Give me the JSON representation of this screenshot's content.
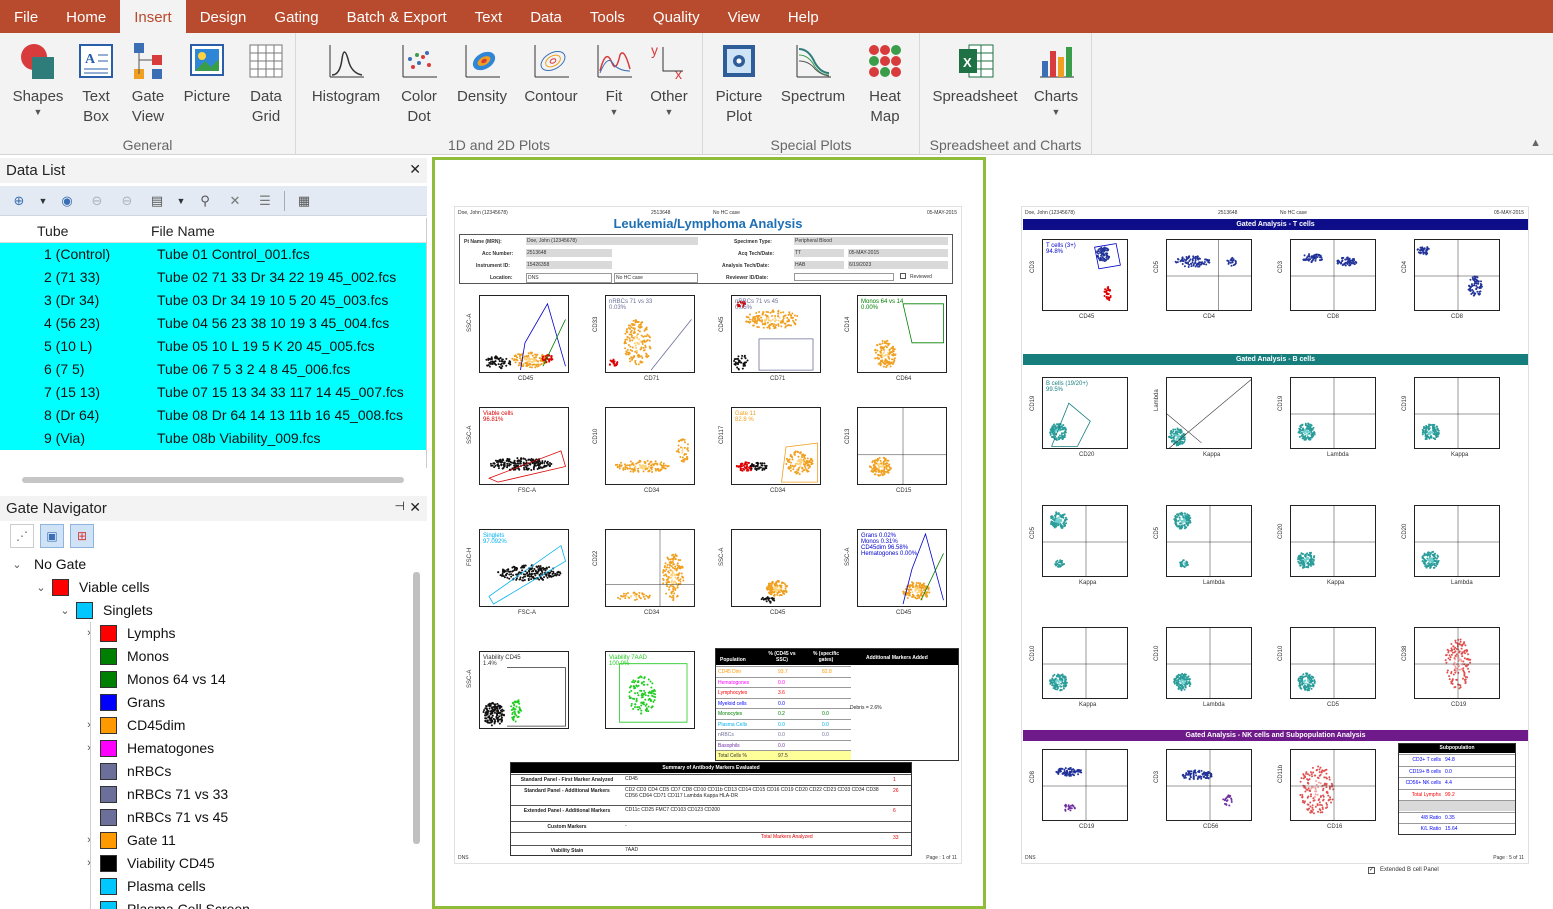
{
  "menu": [
    "File",
    "Home",
    "Insert",
    "Design",
    "Gating",
    "Batch & Export",
    "Text",
    "Data",
    "Tools",
    "Quality",
    "View",
    "Help"
  ],
  "ribbon": {
    "general": {
      "label": "General",
      "buttons": [
        "Shapes",
        "Text\nBox",
        "Gate\nView",
        "Picture",
        "Data\nGrid"
      ]
    },
    "plots": {
      "label": "1D and 2D Plots",
      "buttons": [
        "Histogram",
        "Color\nDot",
        "Density",
        "Contour",
        "Fit",
        "Other"
      ]
    },
    "special": {
      "label": "Special Plots",
      "buttons": [
        "Picture\nPlot",
        "Spectrum",
        "Heat\nMap"
      ]
    },
    "sheet": {
      "label": "Spreadsheet and Charts",
      "buttons": [
        "Spreadsheet",
        "Charts"
      ]
    }
  },
  "datalist": {
    "title": "Data List",
    "col_tube": "Tube",
    "col_file": "File Name",
    "rows": [
      {
        "tube": "1 (Control)",
        "file": "Tube 01 Control_001.fcs"
      },
      {
        "tube": "2 (71 33)",
        "file": "Tube 02 71 33 Dr 34 22 19 45_002.fcs"
      },
      {
        "tube": "3 (Dr 34)",
        "file": "Tube 03 Dr 34 19 10 5 20 45_003.fcs"
      },
      {
        "tube": "4 (56 23)",
        "file": "Tube 04 56 23 38 10 19 3 45_004.fcs"
      },
      {
        "tube": "5 (10 L)",
        "file": "Tube 05 10 L 19 5 K 20 45_005.fcs"
      },
      {
        "tube": "6 (7 5)",
        "file": "Tube 06 7 5 3 2 4 8 45_006.fcs"
      },
      {
        "tube": "7 (15 13)",
        "file": "Tube 07 15 13 34 33 117 14 45_007.fcs"
      },
      {
        "tube": "8 (Dr 64)",
        "file": "Tube 08 Dr 64 14 13 11b 16 45_008.fcs"
      },
      {
        "tube": "9 (Via)",
        "file": "Tube 08b Viability_009.fcs"
      }
    ]
  },
  "gatenav": {
    "title": "Gate Navigator",
    "root": "No Gate",
    "nodes": [
      {
        "label": "Viable cells",
        "color": "#ff0000"
      },
      {
        "label": "Singlets",
        "color": "#00c8ff"
      },
      {
        "label": "Lymphs",
        "color": "#ff0000"
      },
      {
        "label": "Monos",
        "color": "#008000"
      },
      {
        "label": "Monos 64 vs 14",
        "color": "#008000"
      },
      {
        "label": "Grans",
        "color": "#0000ff"
      },
      {
        "label": "CD45dim",
        "color": "#ff9900"
      },
      {
        "label": "Hematogones",
        "color": "#ff00ff"
      },
      {
        "label": "nRBCs",
        "color": "#6b6f9a"
      },
      {
        "label": "nRBCs 71 vs 33",
        "color": "#6b6f9a"
      },
      {
        "label": "nRBCs 71 vs 45",
        "color": "#6b6f9a"
      },
      {
        "label": "Gate 11",
        "color": "#ff9900"
      },
      {
        "label": "Viability CD45",
        "color": "#000000"
      },
      {
        "label": "Plasma cells",
        "color": "#00c8ff"
      },
      {
        "label": "Plasma Cell Screen",
        "color": "#00c8ff"
      }
    ]
  },
  "page1": {
    "hdr_left": "Doe, John (12345678)",
    "hdr_id": "2513648",
    "hdr_mid": "No HC case",
    "hdr_date": "05-MAY-2015",
    "title": "Leukemia/Lymphoma Analysis",
    "info": {
      "pt_label": "Pt Name (MRN):",
      "pt": "Doe, John (12345678)",
      "acc_label": "Acc Number:",
      "acc": "2513648",
      "inst_label": "Instrument ID:",
      "inst": "15426358",
      "loc_label": "Location:",
      "loc": "DNS",
      "nohc": "No HC case",
      "spec_label": "Specimen Type:",
      "spec": "Peripheral Blood",
      "acq_label": "Acq Tech/Date:",
      "acq": "TT",
      "acq_date": "05-MAY-2015",
      "an_label": "Analysis Tech/Date:",
      "an": "HAB",
      "an_date": "6/19/2023",
      "rev_label": "Reviewer ID/Date:",
      "reviewed": "Reviewed"
    },
    "plot_labels": [
      {
        "x": "CD45",
        "y": "SSC-A",
        "t": ""
      },
      {
        "x": "CD71",
        "y": "CD33",
        "t": "nRBCs 71 vs 33\n0.03%"
      },
      {
        "x": "CD71",
        "y": "CD45",
        "t": "nRBCs 71 vs 45\n0.05%"
      },
      {
        "x": "CD64",
        "y": "CD14",
        "t": "Monos 64 vs 14\n0.00%"
      },
      {
        "x": "FSC-A",
        "y": "SSC-A",
        "t": "Viable cells\n96.81%"
      },
      {
        "x": "CD34",
        "y": "CD10",
        "t": ""
      },
      {
        "x": "CD34",
        "y": "CD117",
        "t": "Gate 11\n82.8 %"
      },
      {
        "x": "CD15",
        "y": "CD13",
        "t": ""
      },
      {
        "x": "FSC-A",
        "y": "FSC-H",
        "t": "Singlets\n97.092%"
      },
      {
        "x": "CD34",
        "y": "CD22",
        "t": ""
      },
      {
        "x": "CD45",
        "y": "SSC-A",
        "t": ""
      },
      {
        "x": "CD45",
        "y": "SSC-A",
        "t": "Grans 0.02%\nMonos 0.31%\nCD45dim 96.58%\nHematogones 0.00%"
      },
      {
        "x": "",
        "y": "SSC-A",
        "t": "Viability CD45\n1.4%"
      },
      {
        "x": "",
        "y": "",
        "t": "Viability 7AAD\n100.0%"
      }
    ],
    "pop_table": {
      "h1": "Population",
      "h2": "% (CD45 vs SSC)",
      "h3": "% (specific gates)",
      "h4": "Additional Markers Added",
      "rows": [
        {
          "n": "CD45 Dim",
          "a": "93.7",
          "b": "82.8",
          "c": "#ff9900"
        },
        {
          "n": "Hematogones",
          "a": "0.0",
          "b": "",
          "c": "#ff00ff"
        },
        {
          "n": "Lymphocytes",
          "a": "3.6",
          "b": "",
          "c": "#ff0000"
        },
        {
          "n": "Myeloid cells",
          "a": "0.0",
          "b": "",
          "c": "#0000ff"
        },
        {
          "n": "Monocytes",
          "a": "0.2",
          "b": "0.0",
          "c": "#008000"
        },
        {
          "n": "Plasma Cells",
          "a": "0.0",
          "b": "0.0",
          "c": "#00b0f0"
        },
        {
          "n": "nRBCs",
          "a": "0.0",
          "b": "0.0",
          "c": "#6b6f9a"
        },
        {
          "n": "Basophils",
          "a": "0.0",
          "b": "",
          "c": "#7030a0"
        },
        {
          "n": "Total Cells %",
          "a": "97.5",
          "b": "",
          "c": "#333333"
        }
      ],
      "debris": "Debris = 2.6%"
    },
    "markers": {
      "title": "Summary of Antibody Markers Evaluated",
      "rows": [
        {
          "k": "Standard Panel - First Marker Analyzed",
          "v": "CD45",
          "n": "1"
        },
        {
          "k": "Standard Panel - Additional Markers",
          "v": "CD2 CD3 CD4 CD5 CD7 CD8 CD10 CD11b CD13 CD14 CD15 CD16 CD19 CD20 CD22 CD23 CD33 CD34 CD38 CD56 CD64 CD71 CD117 Lambda Kappa HLA-DR",
          "n": "26"
        },
        {
          "k": "Extended Panel - Additional Markers",
          "v": "CD11c CD25 FMC7 CD103 CD123 CD200",
          "n": "6"
        },
        {
          "k": "Custom Markers",
          "v": "-",
          "n": ""
        },
        {
          "k": "",
          "v": "Total Markers Analyzed",
          "n": "33"
        },
        {
          "k": "Viability Stain",
          "v": "7AAD",
          "n": ""
        }
      ]
    },
    "footer_left": "DNS",
    "footer_page": "Page : 1 of 11"
  },
  "page2": {
    "hdr_left": "Doe, John (12345678)",
    "hdr_id": "2513648",
    "hdr_mid": "No HC case",
    "hdr_date": "05-MAY-2015",
    "sec_t": "Gated Analysis - T cells",
    "sec_b": "Gated Analysis - B cells",
    "sec_nk": "Gated Analysis - NK cells and Subpopulation Analysis",
    "t_plots": [
      {
        "x": "CD45",
        "y": "CD3",
        "t": "T cells (3+)\n94.8%"
      },
      {
        "x": "CD4",
        "y": "CD5",
        "t": ""
      },
      {
        "x": "CD8",
        "y": "CD3",
        "t": ""
      },
      {
        "x": "CD8",
        "y": "CD4",
        "t": ""
      }
    ],
    "b_plots": [
      {
        "x": "CD20",
        "y": "CD19",
        "t": "B cells (19/20+)\n99.5%"
      },
      {
        "x": "Kappa",
        "y": "Lambda",
        "t": ""
      },
      {
        "x": "Lambda",
        "y": "CD19",
        "t": ""
      },
      {
        "x": "Kappa",
        "y": "CD19",
        "t": ""
      },
      {
        "x": "Kappa",
        "y": "CD5",
        "t": ""
      },
      {
        "x": "Lambda",
        "y": "CD5",
        "t": ""
      },
      {
        "x": "Kappa",
        "y": "CD20",
        "t": ""
      },
      {
        "x": "Lambda",
        "y": "CD20",
        "t": ""
      },
      {
        "x": "Kappa",
        "y": "CD10",
        "t": ""
      },
      {
        "x": "Lambda",
        "y": "CD10",
        "t": ""
      },
      {
        "x": "CD5",
        "y": "CD10",
        "t": ""
      },
      {
        "x": "CD19",
        "y": "CD38",
        "t": ""
      }
    ],
    "nk_plots": [
      {
        "x": "CD19",
        "y": "CD8",
        "t": ""
      },
      {
        "x": "CD56",
        "y": "CD3",
        "t": ""
      },
      {
        "x": "CD16",
        "y": "CD11b",
        "t": ""
      }
    ],
    "subpop": {
      "title": "Subpopulation",
      "rows": [
        {
          "k": "CD3+ T cells",
          "v": "94.8",
          "c": "#0000ff"
        },
        {
          "k": "CD19+ B cells",
          "v": "0.0",
          "c": "#0000ff"
        },
        {
          "k": "CD56+ NK cells",
          "v": "4.4",
          "c": "#0000ff"
        },
        {
          "k": "Total Lymphs",
          "v": "99.2",
          "c": "#ff0000"
        },
        {
          "k": "",
          "v": "",
          "c": "#333333"
        },
        {
          "k": "4/8 Ratio",
          "v": "0.35",
          "c": "#0000ff"
        },
        {
          "k": "K/L Ratio",
          "v": "15.64",
          "c": "#0000ff"
        }
      ]
    },
    "footer_left": "DNS",
    "footer_page": "Page : 5 of 11",
    "checkbox_label": "Extended B cell Panel"
  }
}
